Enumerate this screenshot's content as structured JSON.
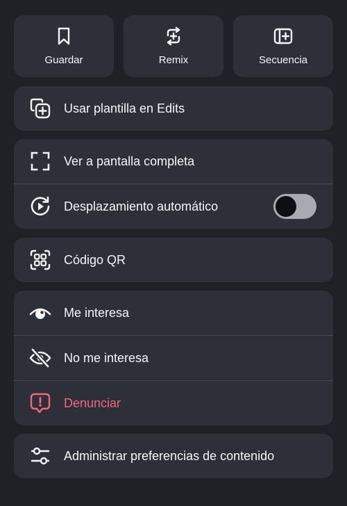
{
  "top_actions": [
    {
      "label": "Guardar",
      "icon": "bookmark-icon"
    },
    {
      "label": "Remix",
      "icon": "remix-icon"
    },
    {
      "label": "Secuencia",
      "icon": "sequence-icon"
    }
  ],
  "edits": {
    "label": "Usar plantilla en Edits",
    "icon": "template-add-icon"
  },
  "view": {
    "fullscreen_label": "Ver a pantalla completa",
    "fullscreen_icon": "fullscreen-icon",
    "autoscroll_label": "Desplazamiento automático",
    "autoscroll_icon": "autoscroll-icon",
    "autoscroll_enabled": false
  },
  "qr": {
    "label": "Código QR",
    "icon": "qr-code-icon"
  },
  "feedback": {
    "interested_label": "Me interesa",
    "interested_icon": "eye-icon",
    "not_interested_label": "No me interesa",
    "not_interested_icon": "eye-off-icon",
    "report_label": "Denunciar",
    "report_icon": "report-icon"
  },
  "preferences": {
    "label": "Administrar preferencias de contenido",
    "icon": "sliders-icon"
  },
  "colors": {
    "background": "#1f2127",
    "panel": "#2d3038",
    "divider": "#474a52",
    "text": "#f5f5f7",
    "danger": "#f2667a",
    "toggle_track": "#a7aab2",
    "toggle_knob": "#0d0f13"
  }
}
